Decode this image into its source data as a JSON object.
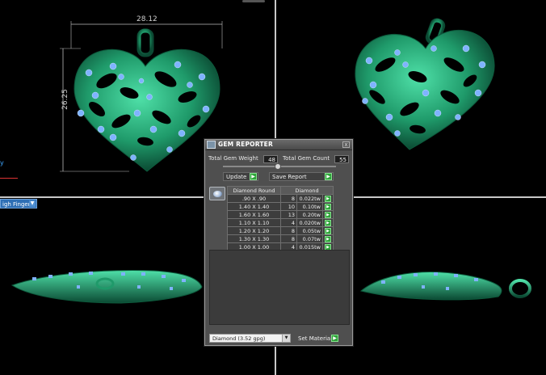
{
  "viewports": {
    "top_left": {
      "width_dim": "28.12",
      "height_dim": "26.25"
    },
    "left_axis_label": "y",
    "view_selector": "igh Finger"
  },
  "dialog": {
    "title": "GEM REPORTER",
    "close_symbol": "x",
    "total_gem_weight_label": "Total Gem Weight",
    "total_gem_weight_value": "48",
    "total_gem_count_label": "Total Gem Count",
    "total_gem_count_value": "55",
    "update_label": "Update",
    "save_report_label": "Save Report",
    "table": {
      "headers": [
        "Diamond Round",
        "Diamond"
      ],
      "rows": [
        {
          "size": ".90 X .90",
          "count": "8",
          "weight": "0.022tw"
        },
        {
          "size": "1.40 X 1.40",
          "count": "10",
          "weight": "0.10tw"
        },
        {
          "size": "1.60 X 1.60",
          "count": "13",
          "weight": "0.20tw"
        },
        {
          "size": "1.10 X 1.10",
          "count": "4",
          "weight": "0.020tw"
        },
        {
          "size": "1.20 X 1.20",
          "count": "8",
          "weight": "0.05tw"
        },
        {
          "size": "1.30 X 1.30",
          "count": "8",
          "weight": "0.07tw"
        },
        {
          "size": "1.00 X 1.00",
          "count": "4",
          "weight": "0.015tw"
        }
      ]
    },
    "material_value": "Diamond      (3.52 gpg)",
    "set_material_label": "Set Material"
  },
  "colors": {
    "metal": "#1f9a6a",
    "gem": "#7fb3ff",
    "dialog_bg": "#4f4f4f",
    "accent_green": "#2fa33a"
  }
}
